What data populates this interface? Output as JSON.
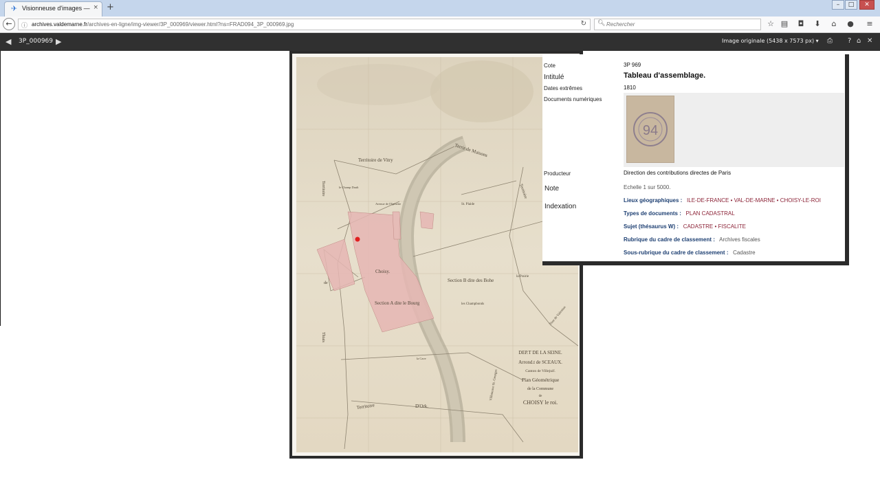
{
  "browser": {
    "tab_title": "Visionneuse d'images — A...",
    "tab_close": "×",
    "new_tab": "+",
    "url_domain": "archives.valdemarne.fr",
    "url_path": "/archives-en-ligne/img-viewer/3P_000969/viewer.html?ns=FRAD094_3P_000969.jpg",
    "search_placeholder": "Rechercher"
  },
  "viewer": {
    "image_name": "3P_000969",
    "original_size_label": "Image originale (5438 x 7573 px)"
  },
  "map": {
    "labels": {
      "territoire_vitry": "Territoire   de   Vitry",
      "terrier": "Terrir   de   Maisons",
      "territoire_left": "Territoire",
      "choisy": "Choisy.",
      "section_a": "Section A dite le Bourg",
      "section_b": "Section B dite des Bohe",
      "territoire_ork": "Territoire",
      "dork": "D'Ork.",
      "de": "de",
      "thiais": "Thiais",
      "la_prairie": "la Prairie",
      "les_champs": "les Champbonds",
      "st_plaide": "St. Plaide",
      "avenue": "Avenue de l'Epinette",
      "le_champ": "le Champ Dault",
      "la_cave": "la Cave",
      "territoire_right": "Territoire",
      "villeneuve": "Villeneuve  St. Georges",
      "tour": "Tour de Valenton"
    },
    "cartouche": {
      "line1": "DEP.T DE LA SEINE.",
      "line2": "Arrond.t de SCEAUX.",
      "line3": "Canton de Villejuif.",
      "line4": "Plan Géométrique",
      "line5": "de la Commune",
      "line6": "de",
      "line7": "CHOISY le roi."
    }
  },
  "record": {
    "cote_label": "Cote",
    "cote_value": "3P 969",
    "intitule_label": "Intitulé",
    "intitule_value": "Tableau d'assemblage.",
    "dates_label": "Dates extrêmes",
    "dates_value": "1810",
    "docs_label": "Documents numériques",
    "producteur_label": "Producteur",
    "producteur_value": "Direction des contributions directes de Paris",
    "note_label": "Note",
    "note_value": "Echelle 1 sur 5000.",
    "indexation_label": "Indexation",
    "thumb_stamp": "94",
    "indexation": {
      "lieux_label": "Lieux géographiques :",
      "lieux_values": "ILE-DE-FRANCE • VAL-DE-MARNE • CHOISY-LE-ROI",
      "types_label": "Types de documents :",
      "types_values": "PLAN CADASTRAL",
      "sujet_label": "Sujet (thésaurus W) :",
      "sujet_values": "CADASTRE • FISCALITE",
      "rubrique_label": "Rubrique du cadre de classement :",
      "rubrique_value": "Archives fiscales",
      "sous_rubrique_label": "Sous-rubrique du cadre de classement :",
      "sous_rubrique_value": "Cadastre"
    }
  }
}
